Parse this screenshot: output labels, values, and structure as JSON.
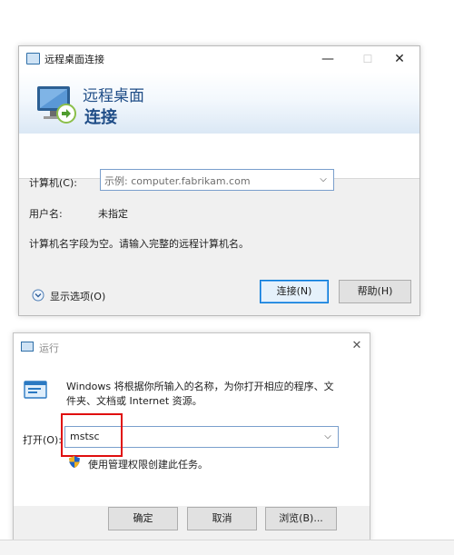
{
  "remote_desktop": {
    "title": "远程桌面连接",
    "minimize": "—",
    "maximize": "☐",
    "close": "✕",
    "banner_line1": "远程桌面",
    "banner_line2": "连接",
    "computer_label": "计算机(C):",
    "computer_placeholder": "示例: computer.fabrikam.com",
    "username_label": "用户名:",
    "username_value": "未指定",
    "message": "计算机名字段为空。请输入完整的远程计算机名。",
    "options_label": "显示选项(O)",
    "connect_button": "连接(N)",
    "help_button": "帮助(H)"
  },
  "run_dialog": {
    "title": "运行",
    "close": "✕",
    "description": "Windows 将根据你所输入的名称，为你打开相应的程序、文件夹、文档或 Internet 资源。",
    "open_label": "打开(O):",
    "open_value": "mstsc",
    "admin_note": "使用管理权限创建此任务。",
    "ok_button": "确定",
    "cancel_button": "取消",
    "browse_button": "浏览(B)..."
  },
  "colors": {
    "highlight": "#e00f0f",
    "accent": "#0078d7",
    "banner_text": "#1f4d87"
  }
}
